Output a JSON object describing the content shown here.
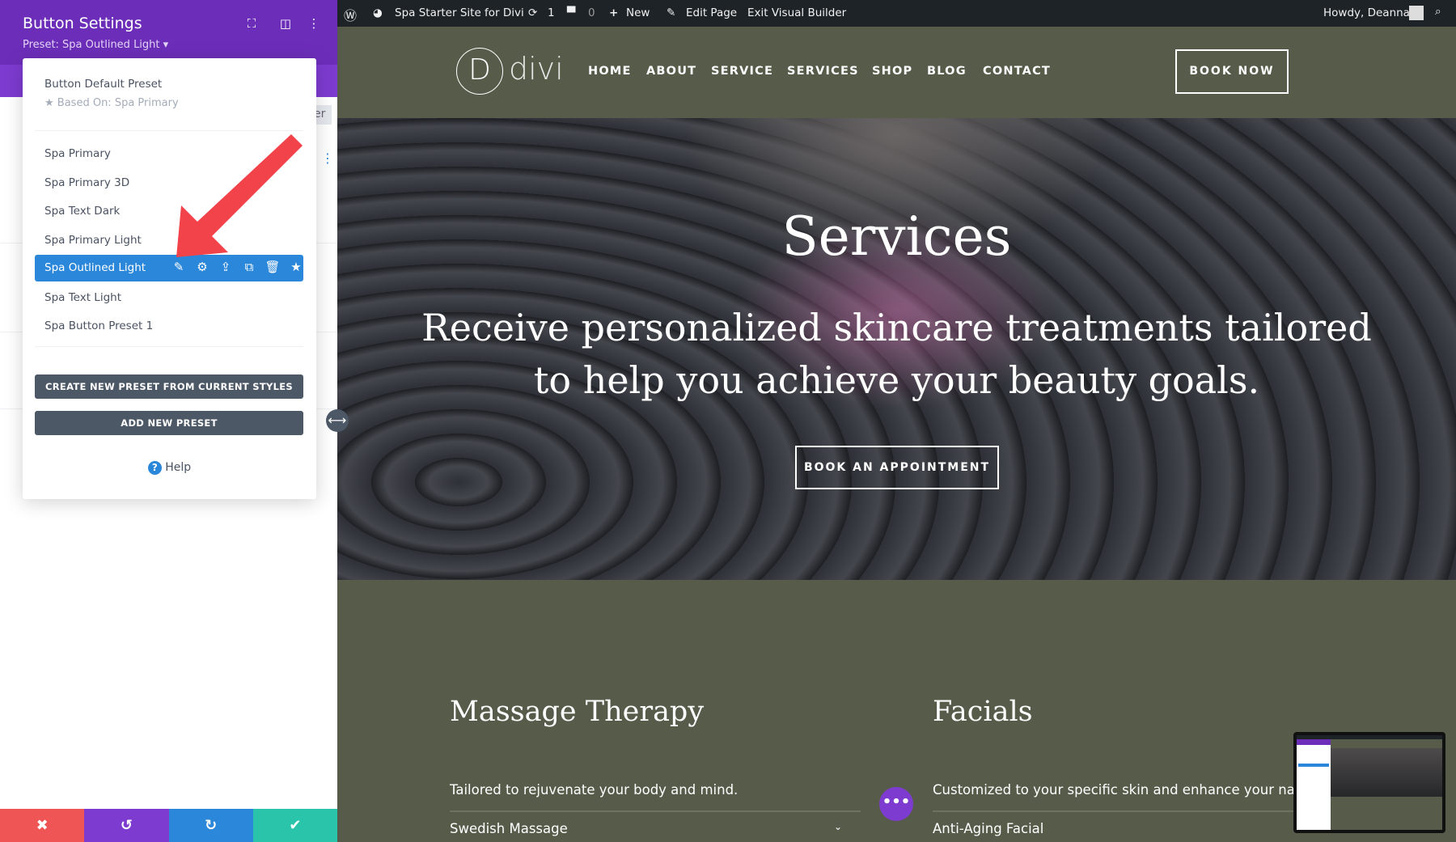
{
  "panel": {
    "title": "Button Settings",
    "preset": "Preset: Spa Outlined Light ▾",
    "tab_partial": "er",
    "icons": [
      "fullscreen-icon",
      "layout-icon",
      "more-icon"
    ],
    "dropdown": {
      "default_label": "Button Default Preset",
      "based_on": "Based On: Spa Primary",
      "items": [
        "Spa Primary",
        "Spa Primary 3D",
        "Spa Text Dark",
        "Spa Primary Light",
        "Spa Outlined Light",
        "Spa Text Light",
        "Spa Button Preset 1"
      ],
      "selected": "Spa Outlined Light",
      "create_label": "CREATE NEW PRESET FROM CURRENT STYLES",
      "add_label": "ADD NEW PRESET",
      "help_label": "Help"
    },
    "bottom": {
      "cancel": "✖",
      "undo": "↺",
      "redo": "↻",
      "save": "✔"
    },
    "colors": {
      "header": "#6c2eb9",
      "selected": "#2b87da",
      "cancel": "#ef5555",
      "undo": "#7e3bd0",
      "redo": "#2b87da",
      "save": "#29c4a9"
    }
  },
  "admin": {
    "site": "Spa Starter Site for Divi",
    "updates": "1",
    "comments": "0",
    "new": "New",
    "edit": "Edit Page",
    "exit": "Exit Visual Builder",
    "howdy": "Howdy, Deanna"
  },
  "site": {
    "logo_letter": "D",
    "logo_text": "divi",
    "nav": [
      "HOME",
      "ABOUT",
      "SERVICE",
      "SERVICES",
      "SHOP",
      "BLOG",
      "CONTACT"
    ],
    "cta": "BOOK NOW",
    "hero": {
      "title": "Services",
      "line1": "Receive personalized skincare treatments tailored",
      "line2": "to help you achieve your beauty goals.",
      "button": "BOOK AN APPOINTMENT"
    },
    "col1": {
      "title": "Massage Therapy",
      "desc": "Tailored to rejuvenate your body and mind.",
      "item": "Swedish Massage"
    },
    "col2": {
      "title": "Facials",
      "desc": "Customized to your specific skin and enhance your natur",
      "item": "Anti-Aging Facial"
    },
    "bg": "#575c4a"
  }
}
